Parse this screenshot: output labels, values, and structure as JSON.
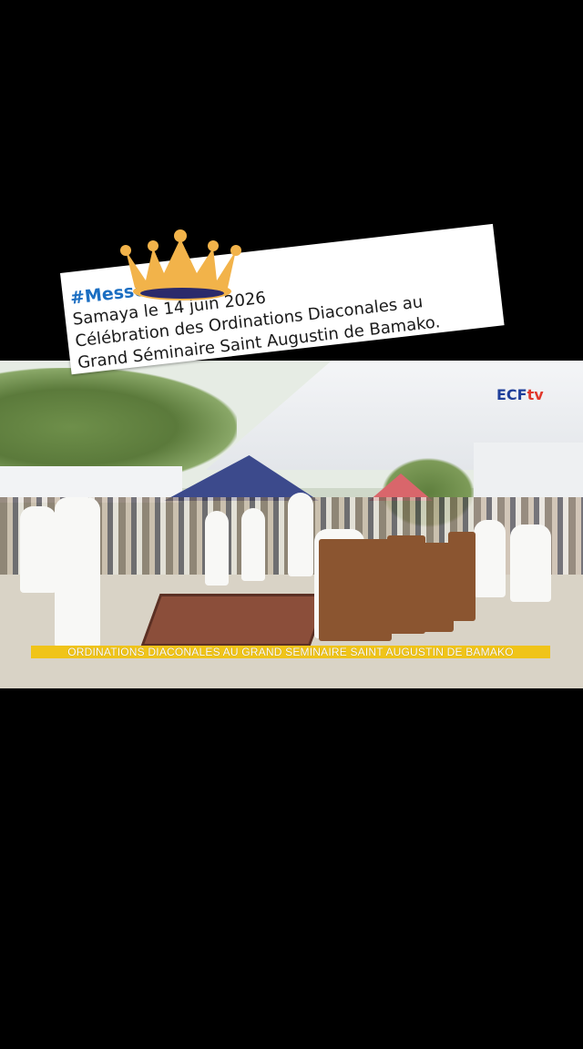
{
  "video": {
    "channel_logo": "ECF",
    "channel_logo_tv": "tv",
    "ticker": "ORDINATIONS DIACONALES AU GRAND SEMINAIRE SAINT AUGUSTIN DE BAMAKO"
  },
  "caption": {
    "hashtag": "#Messe",
    "line1": "Samaya le 14 juin 2026",
    "line2": "Célébration des Ordinations Diaconales au",
    "line3": "Grand Séminaire Saint Augustin de Bamako."
  },
  "sticker": {
    "icon": "crown-icon",
    "color": "#f2b34a",
    "band_color": "#2b2a6b"
  },
  "colors": {
    "background": "#000000",
    "ticker": "#f0c419",
    "hashtag": "#1b6ec2"
  }
}
